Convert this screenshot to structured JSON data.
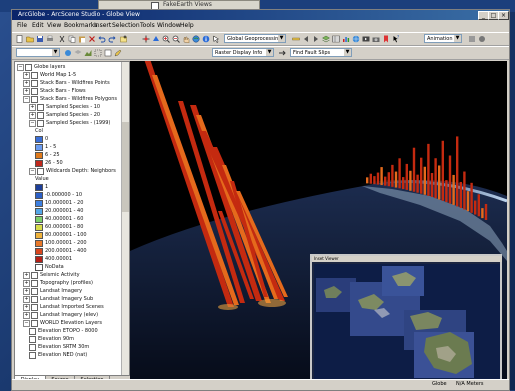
{
  "background_window": {
    "title": "FakeEarth Views"
  },
  "app": {
    "title": "ArcGlobe - ArcScene Studio - Globe View",
    "window_buttons": [
      "_",
      "□",
      "×"
    ]
  },
  "menu": [
    "File",
    "Edit",
    "View",
    "Bookmarks",
    "Insert",
    "Selection",
    "Tools",
    "Window",
    "Help"
  ],
  "toolbar": {
    "globe_dropdown": "Global Geoprocessing",
    "layer_dropdown": "Raster Display Info",
    "search_dropdown": "Find Fault Slips",
    "scale_dropdown": "Animation"
  },
  "toc": {
    "items": [
      {
        "label": "Globe layers",
        "level": 0,
        "expand": "−",
        "checked": true
      },
      {
        "label": "World Map 1-5",
        "level": 1,
        "expand": "+",
        "checked": true
      },
      {
        "label": "Stack Bars - Wildfires Points",
        "level": 1,
        "expand": "+",
        "checked": true
      },
      {
        "label": "Stack Bars - Flows",
        "level": 1,
        "expand": "+",
        "checked": true
      },
      {
        "label": "Stack Bars - Wildfires Polygons",
        "level": 1,
        "expand": "−",
        "checked": true
      },
      {
        "label": "Sampled Species - 10",
        "level": 2,
        "expand": "+",
        "checked": true
      },
      {
        "label": "Sampled Species - 20",
        "level": 2,
        "expand": "+",
        "checked": true
      },
      {
        "label": "Sampled Species - (1999)",
        "level": 2,
        "expand": "−",
        "checked": true
      },
      {
        "label": "Col",
        "level": 3,
        "swatch": ""
      },
      {
        "label": "0",
        "level": 3,
        "swatch": "#3a6fd8"
      },
      {
        "label": "1 - 5",
        "level": 3,
        "swatch": "#6b9cf0"
      },
      {
        "label": "6 - 25",
        "level": 3,
        "swatch": "#e07a1a"
      },
      {
        "label": "26 - 50",
        "level": 3,
        "swatch": "#c0281c"
      },
      {
        "label": "Wildcards Depth: Neighbors",
        "level": 2,
        "expand": "−",
        "checked": true
      },
      {
        "label": "Value",
        "level": 3,
        "swatch": ""
      },
      {
        "label": "1",
        "level": 3,
        "swatch": "#1d3f9a"
      },
      {
        "label": "-0.000000 - 10",
        "level": 3,
        "swatch": "#2b5fc6"
      },
      {
        "label": "10.000001 - 20",
        "level": 3,
        "swatch": "#3d7fe0"
      },
      {
        "label": "20.000001 - 40",
        "level": 3,
        "swatch": "#54a6e8"
      },
      {
        "label": "40.000001 - 60",
        "level": 3,
        "swatch": "#7ccf6a"
      },
      {
        "label": "60.000001 - 80",
        "level": 3,
        "swatch": "#d8dc4a"
      },
      {
        "label": "80.000001 - 100",
        "level": 3,
        "swatch": "#efb23a"
      },
      {
        "label": "100.00001 - 200",
        "level": 3,
        "swatch": "#e8792a"
      },
      {
        "label": "200.00001 - 400",
        "level": 3,
        "swatch": "#d8461e"
      },
      {
        "label": "400.00001",
        "level": 3,
        "swatch": "#b51f16"
      },
      {
        "label": "NoData",
        "level": 3,
        "swatch": "#ffffff"
      },
      {
        "label": "Seismic Activity",
        "level": 1,
        "expand": "+",
        "checked": true
      },
      {
        "label": "Topography (profiles)",
        "level": 1,
        "expand": "+",
        "checked": true
      },
      {
        "label": "Landsat Imagery",
        "level": 1,
        "expand": "+",
        "checked": true
      },
      {
        "label": "Landsat Imagery Sub",
        "level": 1,
        "expand": "+",
        "checked": true
      },
      {
        "label": "Landsat Imported Scenes",
        "level": 1,
        "expand": "+",
        "checked": true
      },
      {
        "label": "Landsat Imagery (elev)",
        "level": 1,
        "expand": "+",
        "checked": true
      },
      {
        "label": "WORLD Elevation Layers",
        "level": 1,
        "expand": "−",
        "checked": true
      },
      {
        "label": "Elevation ETOPO - 8000",
        "level": 2,
        "expand": "",
        "checked": true
      },
      {
        "label": "Elevation 90m",
        "level": 2,
        "expand": "",
        "checked": true
      },
      {
        "label": "Elevation SRTM 30m",
        "level": 2,
        "expand": "",
        "checked": true
      },
      {
        "label": "Elevation NED (nat)",
        "level": 2,
        "expand": "",
        "checked": true
      }
    ]
  },
  "toc_tabs": [
    "Display",
    "Source",
    "Selection"
  ],
  "inset": {
    "title": "Inset Viewer"
  },
  "status": {
    "left": "",
    "right_a": "Globe",
    "right_b": "N/A Meters"
  },
  "colors": {
    "bar_red": "#c42a10",
    "bar_orange": "#e56a1c",
    "globe": "#0f1a33",
    "app_face": "#d4d0c8",
    "title_blue": "#0a246a"
  }
}
